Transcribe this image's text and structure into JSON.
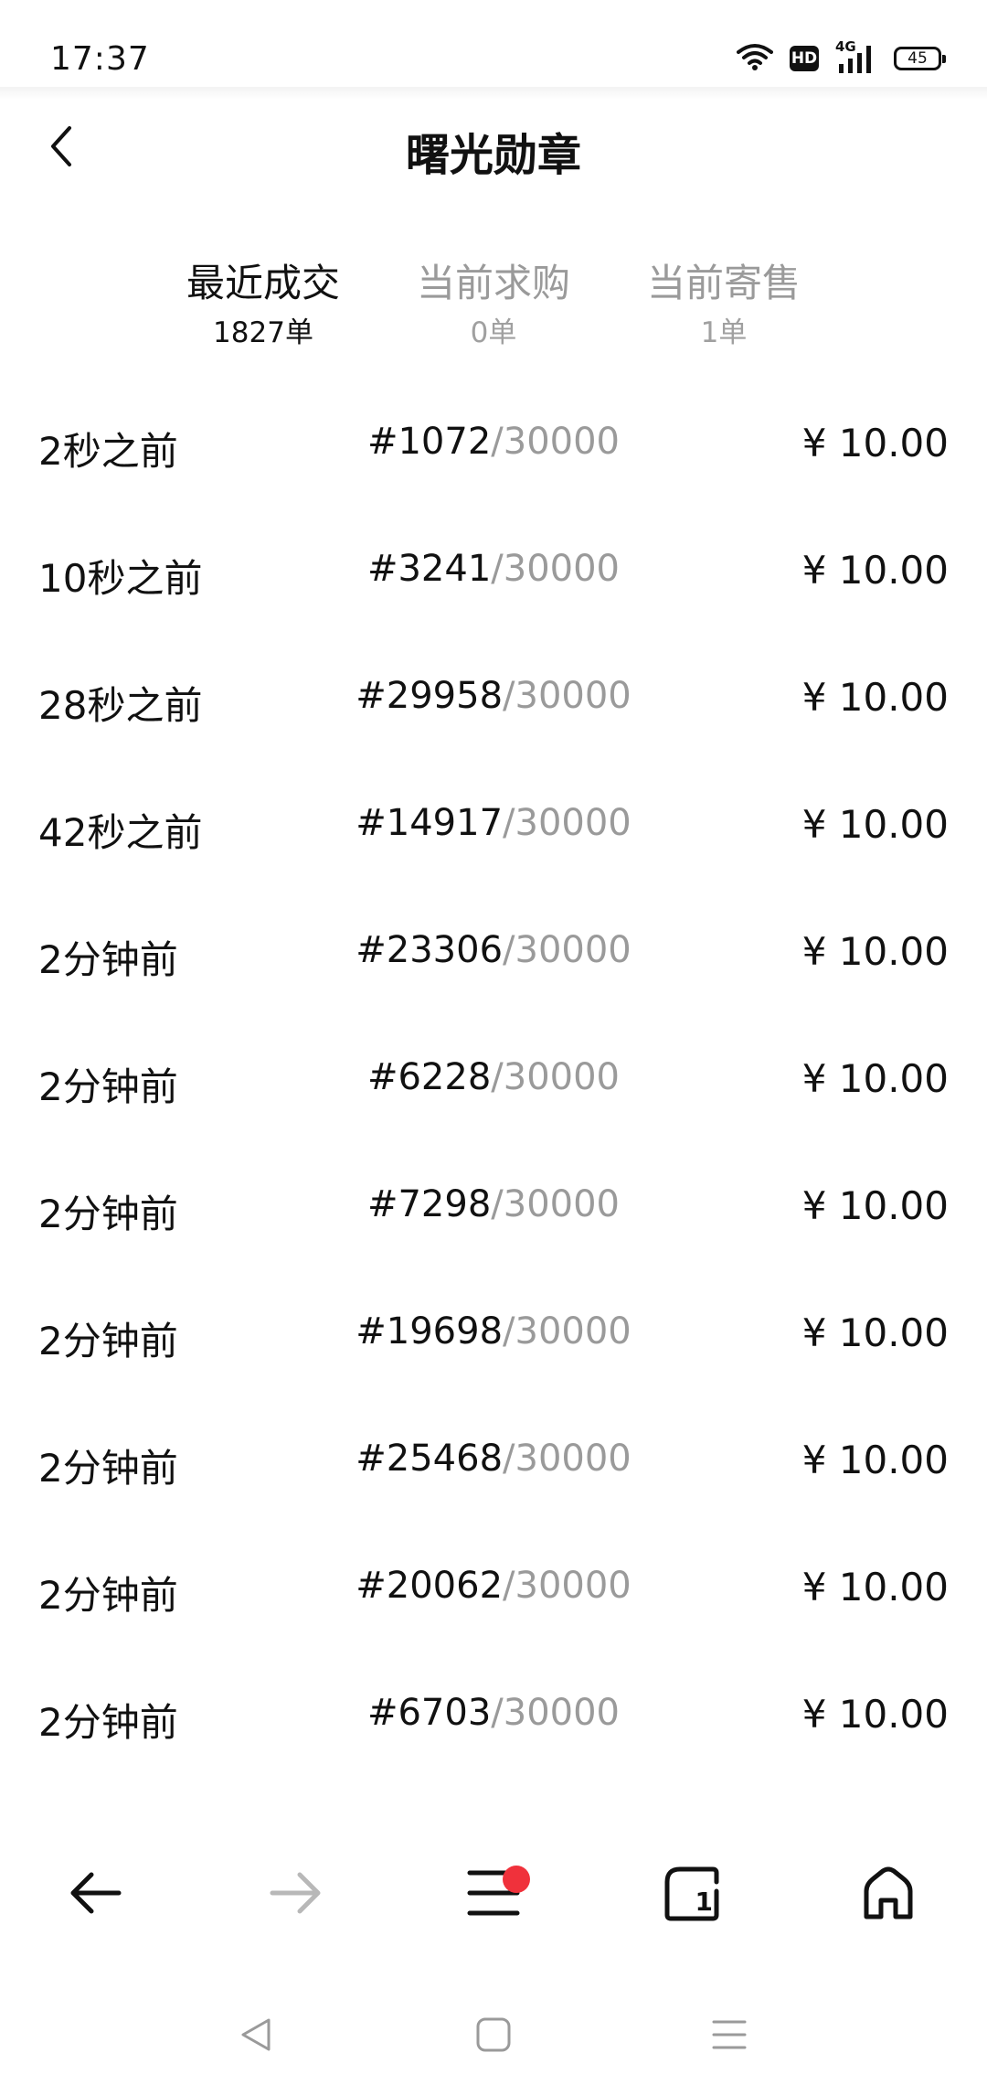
{
  "status_bar": {
    "time": "17:37",
    "hd_label": "HD",
    "network_label": "4G",
    "battery_level": "45"
  },
  "header": {
    "title": "曙光勋章"
  },
  "tabs": [
    {
      "label": "最近成交",
      "count": "1827单",
      "active": true
    },
    {
      "label": "当前求购",
      "count": "0单",
      "active": false
    },
    {
      "label": "当前寄售",
      "count": "1单",
      "active": false
    }
  ],
  "trades": [
    {
      "time": "2秒之前",
      "serial": "#1072",
      "total": "/30000",
      "price": "¥ 10.00"
    },
    {
      "time": "10秒之前",
      "serial": "#3241",
      "total": "/30000",
      "price": "¥ 10.00"
    },
    {
      "time": "28秒之前",
      "serial": "#29958",
      "total": "/30000",
      "price": "¥ 10.00"
    },
    {
      "time": "42秒之前",
      "serial": "#14917",
      "total": "/30000",
      "price": "¥ 10.00"
    },
    {
      "time": "2分钟前",
      "serial": "#23306",
      "total": "/30000",
      "price": "¥ 10.00"
    },
    {
      "time": "2分钟前",
      "serial": "#6228",
      "total": "/30000",
      "price": "¥ 10.00"
    },
    {
      "time": "2分钟前",
      "serial": "#7298",
      "total": "/30000",
      "price": "¥ 10.00"
    },
    {
      "time": "2分钟前",
      "serial": "#19698",
      "total": "/30000",
      "price": "¥ 10.00"
    },
    {
      "time": "2分钟前",
      "serial": "#25468",
      "total": "/30000",
      "price": "¥ 10.00"
    },
    {
      "time": "2分钟前",
      "serial": "#20062",
      "total": "/30000",
      "price": "¥ 10.00"
    },
    {
      "time": "2分钟前",
      "serial": "#6703",
      "total": "/30000",
      "price": "¥ 10.00"
    }
  ],
  "browser_bar": {
    "tab_count": "1",
    "icons": [
      "back-arrow-icon",
      "forward-arrow-icon",
      "menu-icon",
      "tabs-icon",
      "home-icon"
    ],
    "notification_color": "#f0313b"
  },
  "system_nav": {
    "icons": [
      "nav-back-icon",
      "nav-home-icon",
      "nav-recents-icon"
    ]
  }
}
